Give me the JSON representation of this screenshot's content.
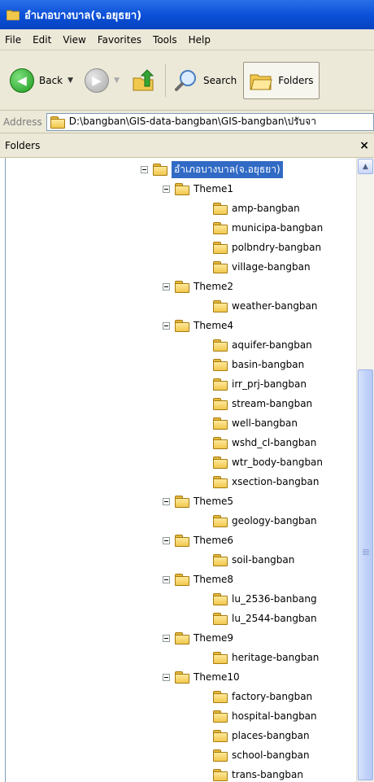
{
  "window": {
    "title": "อำเภอบางบาล(จ.อยุธยา)"
  },
  "menu": [
    "File",
    "Edit",
    "View",
    "Favorites",
    "Tools",
    "Help"
  ],
  "toolbar": {
    "back_label": "Back",
    "search_label": "Search",
    "folders_label": "Folders"
  },
  "address": {
    "label": "Address",
    "value": "D:\\bangban\\GIS-data-bangban\\GIS-bangban\\ปรับจา"
  },
  "pane": {
    "title": "Folders",
    "close_glyph": "×"
  },
  "tree": {
    "root": "อำเภอบางบาล(จ.อยุธยา)",
    "groups": [
      {
        "name": "Theme1",
        "children": [
          "amp-bangban",
          "municipa-bangban",
          "polbndry-bangban",
          "village-bangban"
        ]
      },
      {
        "name": "Theme2",
        "children": [
          "weather-bangban"
        ]
      },
      {
        "name": "Theme4",
        "children": [
          "aquifer-bangban",
          "basin-bangban",
          "irr_prj-bangban",
          "stream-bangban",
          "well-bangban",
          "wshd_cl-bangban",
          "wtr_body-bangban",
          "xsection-bangban"
        ]
      },
      {
        "name": "Theme5",
        "children": [
          "geology-bangban"
        ]
      },
      {
        "name": "Theme6",
        "children": [
          "soil-bangban"
        ]
      },
      {
        "name": "Theme8",
        "children": [
          "lu_2536-banbang",
          "lu_2544-bangban"
        ]
      },
      {
        "name": "Theme9",
        "children": [
          "heritage-bangban"
        ]
      },
      {
        "name": "Theme10",
        "children": [
          "factory-bangban",
          "hospital-bangban",
          "places-bangban",
          "school-bangban",
          "trans-bangban"
        ]
      }
    ]
  }
}
